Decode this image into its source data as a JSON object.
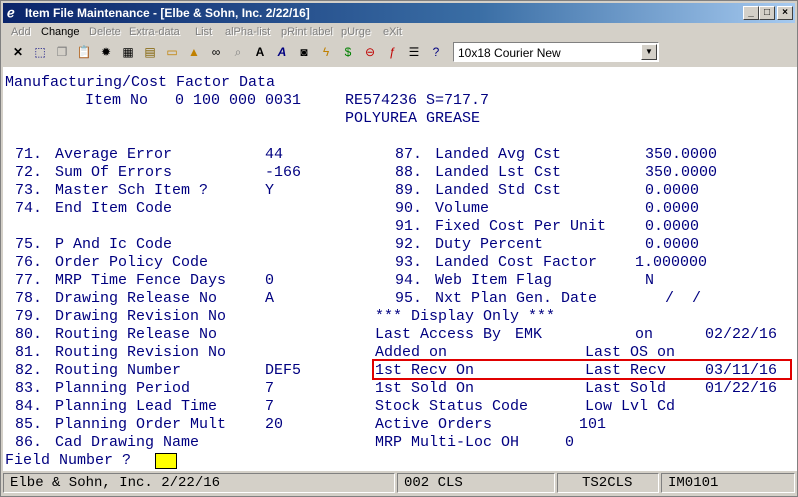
{
  "window": {
    "title": "Item File Maintenance - [Elbe & Sohn, Inc. 2/22/16]",
    "controls": {
      "minimize": "_",
      "maximize": "□",
      "close": "×"
    }
  },
  "menu": [
    "Add",
    "Change",
    "Delete",
    "Extra-data",
    "List",
    "alPha-list",
    "pRint label",
    "pUrge",
    "eXit"
  ],
  "menu_active": "Change",
  "toolbar": {
    "font_select_value": "10x18 Courier New",
    "icons": [
      "delete-icon",
      "select-icon",
      "copy-icon",
      "paste-icon",
      "settings-icon",
      "calculator-icon",
      "notes-icon",
      "folder-icon",
      "alert-icon",
      "binoculars-icon",
      "search-icon",
      "font-a-icon",
      "italic-a-icon",
      "camera-icon",
      "lightning-icon",
      "dollar-icon",
      "link-icon",
      "function-icon",
      "list-icon",
      "help-icon"
    ]
  },
  "screen": {
    "heading": "Manufacturing/Cost Factor Data",
    "item_label": "Item No",
    "item_no": "0 100 000 0031",
    "item_code": "RE574236 S=717.7",
    "item_desc": "POLYUREA GREASE",
    "left_fields": [
      {
        "num": "71.",
        "label": "Average Error",
        "value": "44"
      },
      {
        "num": "72.",
        "label": "Sum Of Errors",
        "value": "-166"
      },
      {
        "num": "73.",
        "label": "Master Sch Item ?",
        "value": "Y"
      },
      {
        "num": "74.",
        "label": "End Item Code",
        "value": ""
      },
      {
        "num": "75.",
        "label": "P And Ic Code",
        "value": ""
      },
      {
        "num": "76.",
        "label": "Order Policy Code",
        "value": ""
      },
      {
        "num": "77.",
        "label": "MRP Time Fence Days",
        "value": "0"
      },
      {
        "num": "78.",
        "label": "Drawing Release No",
        "value": "A"
      },
      {
        "num": "79.",
        "label": "Drawing Revision No",
        "value": ""
      },
      {
        "num": "80.",
        "label": "Routing Release No",
        "value": ""
      },
      {
        "num": "81.",
        "label": "Routing Revision No",
        "value": ""
      },
      {
        "num": "82.",
        "label": "Routing Number",
        "value": "DEF5"
      },
      {
        "num": "83.",
        "label": "Planning Period",
        "value": "7"
      },
      {
        "num": "84.",
        "label": "Planning Lead Time",
        "value": "7"
      },
      {
        "num": "85.",
        "label": "Planning Order Mult",
        "value": "20"
      },
      {
        "num": "86.",
        "label": "Cad Drawing Name",
        "value": ""
      }
    ],
    "right_fields": [
      {
        "num": "87.",
        "label": "Landed Avg Cst",
        "value": "350.0000"
      },
      {
        "num": "88.",
        "label": "Landed Lst Cst",
        "value": "350.0000"
      },
      {
        "num": "89.",
        "label": "Landed Std Cst",
        "value": "0.0000"
      },
      {
        "num": "90.",
        "label": "Volume",
        "value": "0.0000"
      },
      {
        "num": "91.",
        "label": "Fixed Cost Per Unit",
        "value": "0.0000"
      },
      {
        "num": "92.",
        "label": "Duty Percent",
        "value": "0.0000"
      },
      {
        "num": "93.",
        "label": "Landed Cost Factor",
        "value": "1.000000"
      },
      {
        "num": "94.",
        "label": "Web Item Flag",
        "value": "N"
      },
      {
        "num": "95.",
        "label": "Nxt Plan Gen. Date",
        "value": "/  /"
      }
    ],
    "display_only_header": "*** Display Only ***",
    "display_only": {
      "last_access_by_label": "Last Access By",
      "last_access_by": "EMK",
      "on_label": "on",
      "last_access_on": "02/22/16",
      "added_on_label": "Added on",
      "last_os_on_label": "Last OS on",
      "first_recv_on_label": "1st Recv On",
      "last_recv_label": "Last Recv",
      "last_recv": "03/11/16",
      "first_sold_on_label": "1st Sold On",
      "last_sold_label": "Last Sold",
      "last_sold": "01/22/16",
      "stock_status_label": "Stock Status Code",
      "low_lvl_label": "Low Lvl Cd",
      "active_orders_label": "Active Orders",
      "active_orders": "101",
      "mrp_multi_loc_label": "MRP Multi-Loc OH",
      "mrp_multi_loc": "0"
    }
  },
  "prompt": {
    "label": "Field Number ?"
  },
  "status": {
    "company": "Elbe & Sohn, Inc. 2/22/16",
    "code1": "002 CLS",
    "code2": "TS2CLS",
    "code3": "IM0101"
  },
  "colors": {
    "text": "#000080",
    "highlight": "#e00000",
    "cursor": "#ffff00",
    "title_bar": "#0a246a"
  }
}
